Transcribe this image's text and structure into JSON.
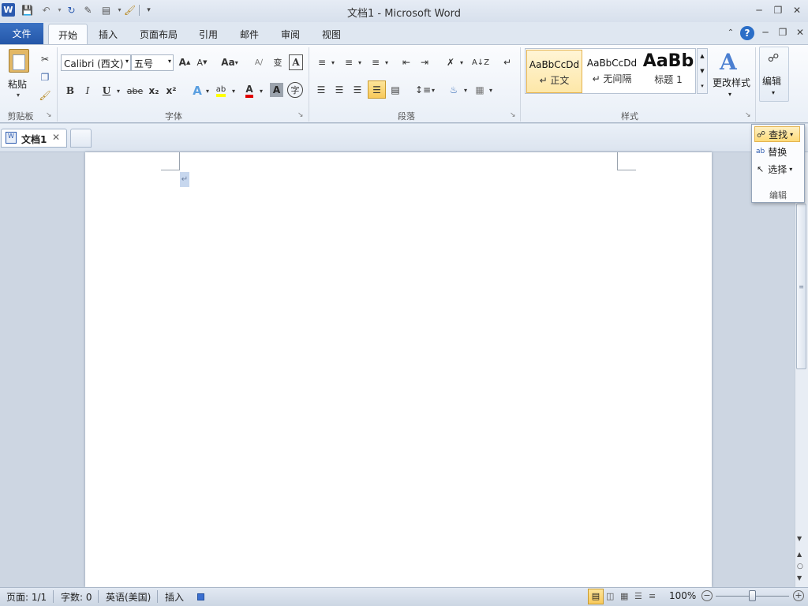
{
  "window": {
    "title": "文档1 - Microsoft Word"
  },
  "ribbon_tabs": [
    "文件",
    "开始",
    "插入",
    "页面布局",
    "引用",
    "邮件",
    "审阅",
    "视图"
  ],
  "clipboard": {
    "paste_label": "粘贴",
    "group_label": "剪贴板"
  },
  "font": {
    "font_name": "Calibri (西文)",
    "font_size": "五号",
    "group_label": "字体",
    "change_case": "Aa",
    "bold": "B",
    "italic": "I",
    "underline": "U",
    "strike": "abe",
    "subscript": "x₂",
    "superscript": "x²",
    "grow": "A",
    "shrink": "A"
  },
  "paragraph": {
    "group_label": "段落"
  },
  "styles": {
    "group_label": "样式",
    "items": [
      {
        "sample": "AaBbCcDd",
        "name": "↵ 正文"
      },
      {
        "sample": "AaBbCcDd",
        "name": "↵ 无间隔"
      },
      {
        "sample": "AaBb",
        "name": "标题 1"
      }
    ],
    "change_styles_label": "更改样式"
  },
  "editing": {
    "label": "编辑",
    "group_label": "编辑",
    "find": "查找",
    "replace": "替换",
    "select": "选择"
  },
  "doc_tabs": {
    "active": "文档1"
  },
  "document": {
    "para_mark": "↵"
  },
  "status": {
    "page": "页面: 1/1",
    "words": "字数: 0",
    "language": "英语(美国)",
    "insert_mode": "插入",
    "zoom": "100%"
  },
  "colors": {
    "file_tab": "#2457a8",
    "selection": "#c7d7ee",
    "highlight": "#ffff00",
    "font_color": "#e00000"
  }
}
